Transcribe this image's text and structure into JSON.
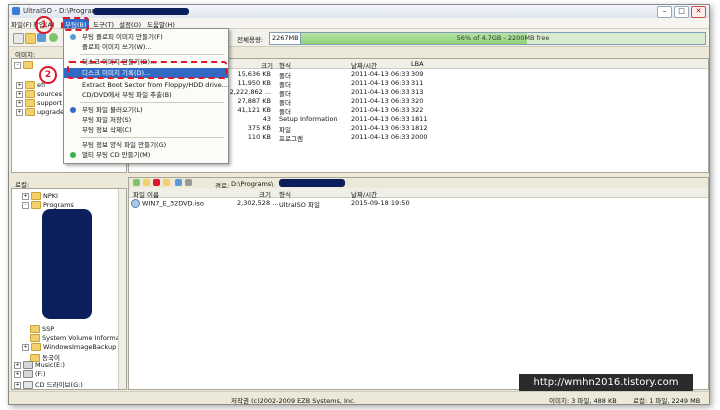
{
  "window": {
    "title": "UltraISO - D:\\Programs\\",
    "controls": [
      "–",
      "□",
      "✕"
    ]
  },
  "menubar": {
    "items": [
      "파일(F)",
      "작업(A)",
      "부팅(B)",
      "도구(T)",
      "설정(O)",
      "도움말(H)"
    ]
  },
  "toolbar": {
    "image_label": "이미지:",
    "size_label": "전체용량:",
    "size_value": "2267MB",
    "usage_text": "56% of 4.7GB - 2200MB free",
    "usage_percent": 56
  },
  "boot_menu": {
    "items": [
      {
        "label": "부팅 플로피 이미지 만들기(F)",
        "icon": "floppy-icon"
      },
      {
        "label": "플로피 이미지 쓰기(W)...",
        "icon": ""
      },
      {
        "label": "디스크 이미지 만들기(D)...",
        "icon": ""
      },
      {
        "label": "디스크 이미지 기록(D)...",
        "icon": ""
      },
      {
        "label": "Extract Boot Sector from Floppy/HDD drive...",
        "icon": ""
      },
      {
        "label": "CD/DVD에서 부팅 파일 추출(B)",
        "icon": ""
      },
      {
        "label": "부팅 파일 불러오기(L)",
        "icon": "disc-icon"
      },
      {
        "label": "부팅 파일 저장(S)",
        "icon": ""
      },
      {
        "label": "부팅 정보 삭제(C)",
        "icon": ""
      },
      {
        "label": "부팅 정보 양식 파일 만들기(G)",
        "icon": ""
      },
      {
        "label": "멀티 부팅 CD 만들기(M)",
        "icon": "globe-icon"
      }
    ]
  },
  "upper_tree": [
    "efi",
    "sources",
    "support",
    "upgrade"
  ],
  "upper_list": {
    "headers": [
      "크기",
      "형식",
      "날짜/시간",
      "LBA"
    ],
    "rows": [
      {
        "size": "15,636 KB",
        "type": "폴더",
        "date": "2011-04-13 06:33",
        "lba": "309"
      },
      {
        "size": "11,950 KB",
        "type": "폴더",
        "date": "2011-04-13 06:33",
        "lba": "311"
      },
      {
        "size": "2,222,862 ...",
        "type": "폴더",
        "date": "2011-04-13 06:33",
        "lba": "313"
      },
      {
        "size": "27,887 KB",
        "type": "폴더",
        "date": "2011-04-13 06:33",
        "lba": "320"
      },
      {
        "size": "41,121 KB",
        "type": "폴더",
        "date": "2011-04-13 06:33",
        "lba": "322"
      },
      {
        "size": "43",
        "type": "Setup Information",
        "date": "2011-04-13 06:33",
        "lba": "1811"
      },
      {
        "size": "375 KB",
        "type": "파일",
        "date": "2011-04-13 06:33",
        "lba": "1812"
      },
      {
        "size": "110 KB",
        "type": "프로그램",
        "date": "2011-04-13 06:33",
        "lba": "2000"
      }
    ]
  },
  "local": {
    "label": "로컬:",
    "path_label": "경로:",
    "path_value": "D:\\Programs\\",
    "tree": [
      "NPKI",
      "Programs",
      "SSP",
      "System Volume Informa",
      "WindowsImageBackup",
      "동국이",
      "Music(E:)",
      "(F:)",
      "CD 드라이브(G:)"
    ],
    "headers": [
      "파일 이름",
      "크기",
      "형식",
      "날짜/시간"
    ],
    "rows": [
      {
        "name": "WIN7_E_32DVD.iso",
        "size": "2,302,528 ...",
        "type": "UltraISO 파일",
        "date": "2015-09-18 19:50"
      }
    ]
  },
  "status": {
    "copyright": "저작권 (c)2002-2009 EZB Systems, Inc.",
    "image_info": "이미지: 3 파일, 488 KB",
    "local_info": "로컬: 1 파일, 2249 MB"
  },
  "watermark": "http://wmhn2016.tistory.com",
  "annotations": {
    "step1": "1",
    "step2": "2"
  },
  "colors": {
    "accent": "#316ac5",
    "highlight_red": "#e0162b",
    "redact": "#0b1f5c"
  }
}
